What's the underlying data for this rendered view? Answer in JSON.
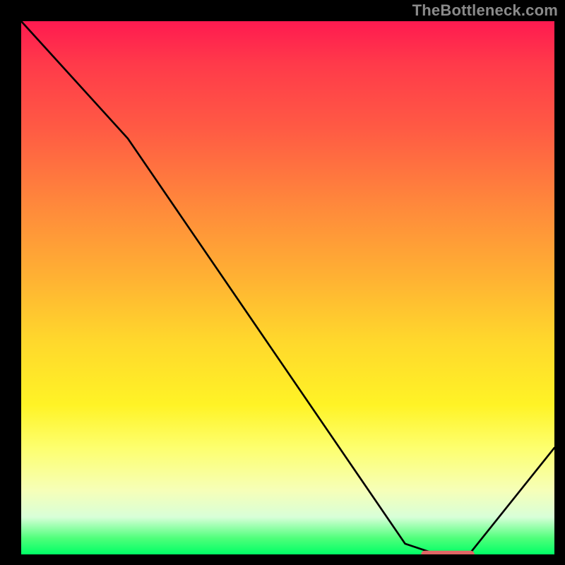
{
  "watermark": "TheBottleneck.com",
  "chart_data": {
    "type": "line",
    "title": "",
    "xlabel": "",
    "ylabel": "",
    "xlim": [
      0,
      100
    ],
    "ylim": [
      0,
      100
    ],
    "series": [
      {
        "name": "bottleneck-curve",
        "x": [
          0,
          20,
          72,
          78,
          84,
          100
        ],
        "y": [
          100,
          78,
          2,
          0,
          0,
          20
        ]
      }
    ],
    "marker": {
      "name": "optimal-zone",
      "x_start": 75,
      "x_end": 85,
      "y": 0,
      "color": "#e06666"
    },
    "background": {
      "type": "vertical-gradient",
      "stops": [
        {
          "pos": 0,
          "color": "#ff1a50"
        },
        {
          "pos": 50,
          "color": "#ffc030"
        },
        {
          "pos": 80,
          "color": "#fdff6e"
        },
        {
          "pos": 100,
          "color": "#00ff66"
        }
      ]
    }
  }
}
